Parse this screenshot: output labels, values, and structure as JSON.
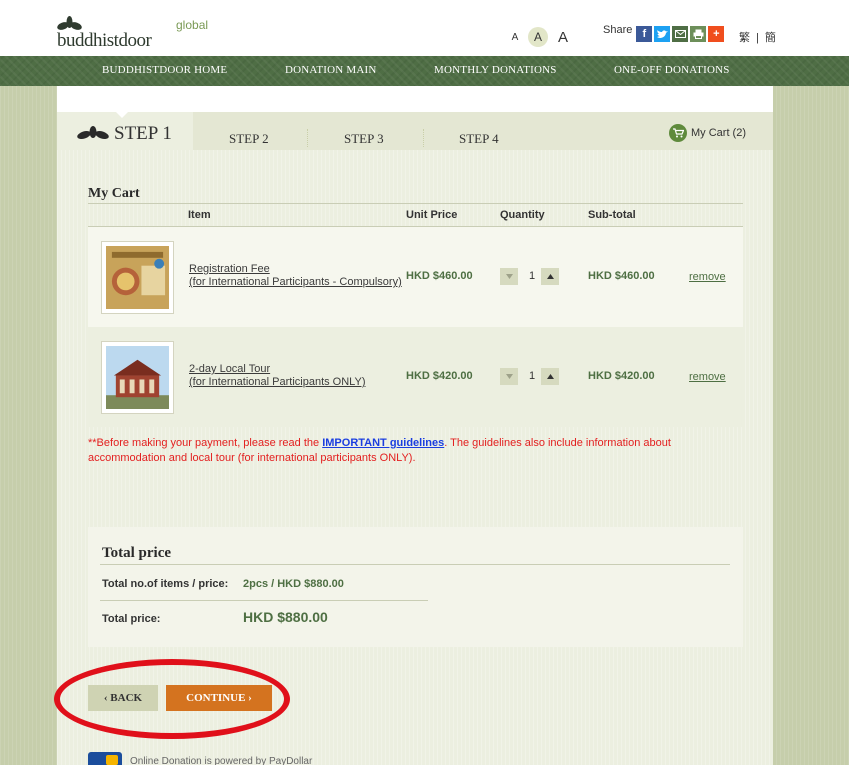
{
  "header": {
    "logo_small": "global",
    "logo_main": "buddhistdoor",
    "font_sizes": [
      "A",
      "A",
      "A"
    ],
    "share_label": "Share",
    "share_icons": [
      "facebook-icon",
      "twitter-icon",
      "email-icon",
      "print-icon",
      "plus-icon"
    ],
    "lang_traditional": "繁",
    "lang_sep": "|",
    "lang_simplified": "簡"
  },
  "nav": {
    "items": [
      "BUDDHISTDOOR HOME",
      "DONATION MAIN",
      "MONTHLY DONATIONS",
      "ONE-OFF DONATIONS"
    ]
  },
  "steps": {
    "items": [
      "STEP 1",
      "STEP 2",
      "STEP 3",
      "STEP 4"
    ],
    "cart": "My Cart (2)"
  },
  "cart": {
    "title": "My Cart",
    "columns": [
      "Item",
      "Unit Price",
      "Quantity",
      "Sub-total"
    ],
    "rows": [
      {
        "name_line1": "Registration Fee",
        "name_line2": "(for International Participants - Compulsory)",
        "unit_price": "HKD $460.00",
        "quantity": "1",
        "subtotal": "HKD $460.00",
        "remove": "remove"
      },
      {
        "name_line1": "2-day Local Tour",
        "name_line2": "(for International Participants ONLY)",
        "unit_price": "HKD $420.00",
        "quantity": "1",
        "subtotal": "HKD $420.00",
        "remove": "remove"
      }
    ],
    "notice_before": "**Before making your payment, please read the ",
    "notice_link": "IMPORTANT guidelines",
    "notice_after": ". The guidelines also include information about accommodation and local tour (for international participants ONLY)."
  },
  "total": {
    "title": "Total price",
    "items_label": "Total no.of items / price:",
    "items_value": "2pcs / HKD $880.00",
    "price_label": "Total price:",
    "price_value": "HKD $880.00"
  },
  "buttons": {
    "back": "‹ BACK",
    "continue": "CONTINUE ›"
  },
  "footer": {
    "text": "Online Donation is powered by PayDollar"
  },
  "colors": {
    "nav_green": "#4f6e45",
    "accent_green": "#4e6f43",
    "continue_orange": "#d4731f",
    "notice_red": "#e32020",
    "highlight_red": "#e0101a"
  }
}
